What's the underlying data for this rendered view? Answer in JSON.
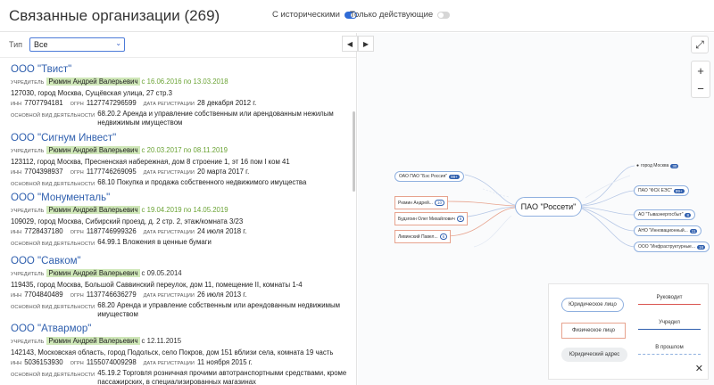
{
  "header": {
    "title": "Связанные организации (269)",
    "toggle_historical": "С историческими",
    "toggle_active": "Только действующие"
  },
  "filter": {
    "label": "Тип",
    "value": "Все"
  },
  "labels": {
    "founder": "УЧРЕДИТЕЛЬ",
    "inn": "ИНН",
    "ogrn": "ОГРН",
    "reg_date": "ДАТА РЕГИСТРАЦИИ",
    "activity": "ОСНОВНОЙ ВИД ДЕЯТЕЛЬНОСТИ"
  },
  "orgs": [
    {
      "name": "ООО \"Твист\"",
      "person": "Рюмин Андрей Валерьевич",
      "dates": "с 16.06.2016 по 13.03.2018",
      "address": "127030, город Москва, Сущёвская улица, 27 стр.3",
      "inn": "7707794181",
      "ogrn": "1127747296599",
      "reg_date": "28 декабря 2012 г.",
      "activity": "68.20.2 Аренда и управление собственным или арендованным нежилым недвижимым имуществом"
    },
    {
      "name": "ООО \"Сигнум Инвест\"",
      "person": "Рюмин Андрей Валерьевич",
      "dates": "с 20.03.2017 по 08.11.2019",
      "address": "123112, город Москва, Пресненская набережная, дом 8 строение 1, эт 16 пом I ком 41",
      "inn": "7704398937",
      "ogrn": "1177746269095",
      "reg_date": "20 марта 2017 г.",
      "activity": "68.10 Покупка и продажа собственного недвижимого имущества"
    },
    {
      "name": "ООО \"Монументаль\"",
      "person": "Рюмин Андрей Валерьевич",
      "dates": "с 19.04.2019 по 14.05.2019",
      "address": "109029, город Москва, Сибирский проезд, д. 2 стр. 2, этаж/комната 3/23",
      "inn": "7728437180",
      "ogrn": "1187746999326",
      "reg_date": "24 июля 2018 г.",
      "activity": "64.99.1 Вложения в ценные бумаги"
    },
    {
      "name": "ООО \"Савком\"",
      "person": "Рюмин Андрей Валерьевич",
      "dates": "с 09.05.2014",
      "address": "119435, город Москва, Большой Саввинский переулок, дом 11, помещение II, комнаты 1-4",
      "inn": "7704840489",
      "ogrn": "1137746636279",
      "reg_date": "26 июля 2013 г.",
      "activity": "68.20 Аренда и управление собственным или арендованным недвижимым имуществом"
    },
    {
      "name": "ООО \"Атвармор\"",
      "person": "Рюмин Андрей Валерьевич",
      "dates": "с 12.11.2015",
      "address": "142143, Московская область, город Подольск, село Покров, дом 151 вблизи села, комната 19 часть",
      "inn": "5036153930",
      "ogrn": "1155074009298",
      "reg_date": "11 ноября 2015 г.",
      "activity": "45.19.2 Торговля розничная прочими автотранспортными средствами, кроме пассажирских, в специализированных магазинах"
    }
  ],
  "graph": {
    "center": "ПАО \"Россети\"",
    "left_nodes": [
      {
        "label": "ОАО ПАО \"Бэс Россия\"",
        "badge": "99+"
      },
      {
        "label": "Рюмин Андрей...",
        "badge": "10"
      },
      {
        "label": "Будзгоин Олег Михайлович",
        "badge": "8"
      },
      {
        "label": "Ливинский Павел...",
        "badge": "6"
      }
    ],
    "right_nodes": [
      {
        "label": "город Москва",
        "badge": "30"
      },
      {
        "label": "ПАО \"ФСК ЕЭС\"",
        "badge": "99+"
      },
      {
        "label": "АО \"Тываэнергосбыт\"",
        "badge": "8"
      },
      {
        "label": "АНО \"Инновационный...",
        "badge": "11"
      },
      {
        "label": "ООО \"Инфраструктурные...",
        "badge": "18"
      }
    ]
  },
  "legend": {
    "legal": "Юридическое лицо",
    "physical": "Физическое лицо",
    "address": "Юридический адрес",
    "leads": "Руководит",
    "founded": "Учредил",
    "past": "В прошлом"
  },
  "colors": {
    "accent": "#2f5fae",
    "founder_highlight": "#cfe7b8",
    "dates_green": "#6aa334",
    "phys_border": "#e7a38e"
  }
}
